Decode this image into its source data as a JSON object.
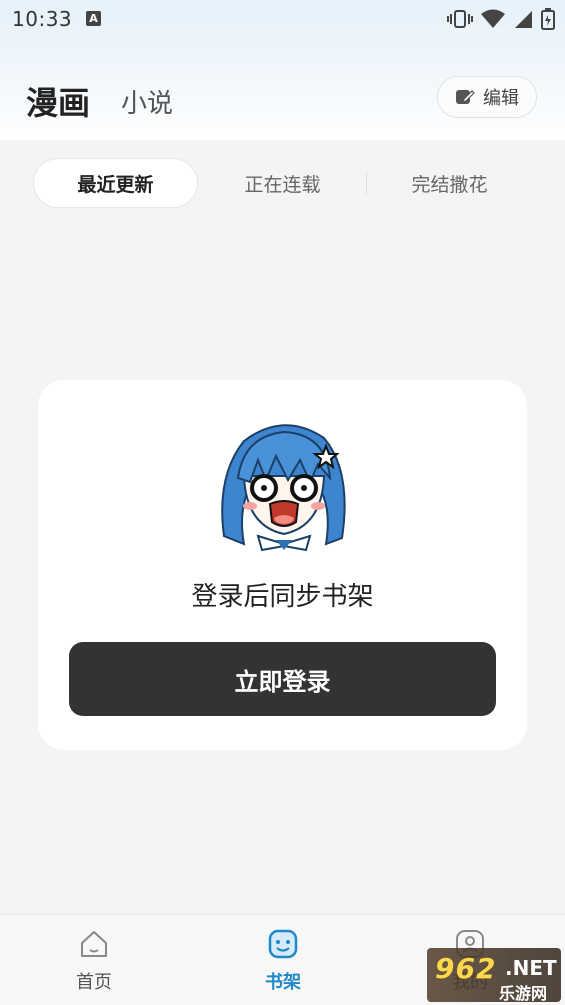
{
  "status_bar": {
    "time": "10:33",
    "notification_badge": "A"
  },
  "header": {
    "title": "漫画",
    "subtitle": "小说",
    "edit_label": "编辑"
  },
  "tabs": [
    {
      "label": "最近更新",
      "active": true
    },
    {
      "label": "正在连载",
      "active": false
    },
    {
      "label": "完结撒花",
      "active": false
    }
  ],
  "empty_state": {
    "message": "登录后同步书架",
    "login_button": "立即登录"
  },
  "bottom_nav": [
    {
      "label": "首页",
      "icon": "home-icon",
      "active": false
    },
    {
      "label": "书架",
      "icon": "bookshelf-icon",
      "active": true
    },
    {
      "label": "我的",
      "icon": "profile-icon",
      "active": false
    }
  ],
  "watermark": {
    "brand": "962",
    "suffix": ".NET",
    "site": "乐游网"
  },
  "colors": {
    "accent": "#1e88c8",
    "button_dark": "#333333",
    "background": "#f4f4f4"
  }
}
